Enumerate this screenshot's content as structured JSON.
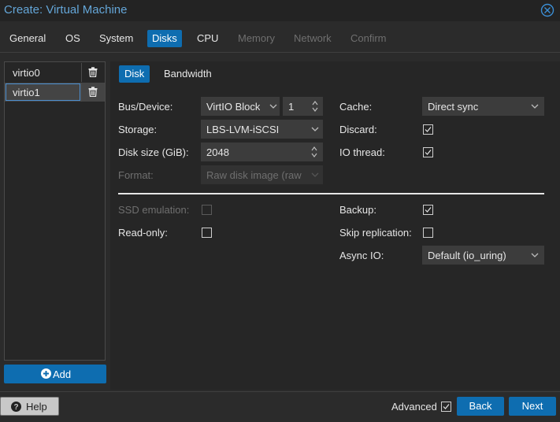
{
  "window": {
    "title": "Create: Virtual Machine",
    "close_icon": "close-icon"
  },
  "tabs": [
    {
      "label": "General",
      "state": "enabled"
    },
    {
      "label": "OS",
      "state": "enabled"
    },
    {
      "label": "System",
      "state": "enabled"
    },
    {
      "label": "Disks",
      "state": "active"
    },
    {
      "label": "CPU",
      "state": "enabled"
    },
    {
      "label": "Memory",
      "state": "disabled"
    },
    {
      "label": "Network",
      "state": "disabled"
    },
    {
      "label": "Confirm",
      "state": "disabled"
    }
  ],
  "disks": {
    "items": [
      {
        "label": "virtio0",
        "selected": false
      },
      {
        "label": "virtio1",
        "selected": true
      }
    ],
    "add_label": "Add"
  },
  "subtabs": [
    {
      "label": "Disk",
      "active": true
    },
    {
      "label": "Bandwidth",
      "active": false
    }
  ],
  "form": {
    "bus_device": {
      "label": "Bus/Device:",
      "bus": "VirtIO Block",
      "device": "1"
    },
    "storage": {
      "label": "Storage:",
      "value": "LBS-LVM-iSCSI"
    },
    "disk_size": {
      "label": "Disk size (GiB):",
      "value": "2048"
    },
    "format": {
      "label": "Format:",
      "value": "Raw disk image (raw",
      "disabled": true
    },
    "cache": {
      "label": "Cache:",
      "value": "Direct sync"
    },
    "discard": {
      "label": "Discard:",
      "checked": true
    },
    "io_thread": {
      "label": "IO thread:",
      "checked": true
    },
    "ssd_emulation": {
      "label": "SSD emulation:",
      "checked": false,
      "disabled": true
    },
    "read_only": {
      "label": "Read-only:",
      "checked": false
    },
    "backup": {
      "label": "Backup:",
      "checked": true
    },
    "skip_replication": {
      "label": "Skip replication:",
      "checked": false
    },
    "async_io": {
      "label": "Async IO:",
      "value": "Default (io_uring)"
    }
  },
  "footer": {
    "help_label": "Help",
    "advanced_label": "Advanced",
    "advanced_checked": true,
    "back_label": "Back",
    "next_label": "Next"
  },
  "colors": {
    "accent": "#0e6db0",
    "title": "#64a6d8",
    "background": "#2b2b2b"
  }
}
